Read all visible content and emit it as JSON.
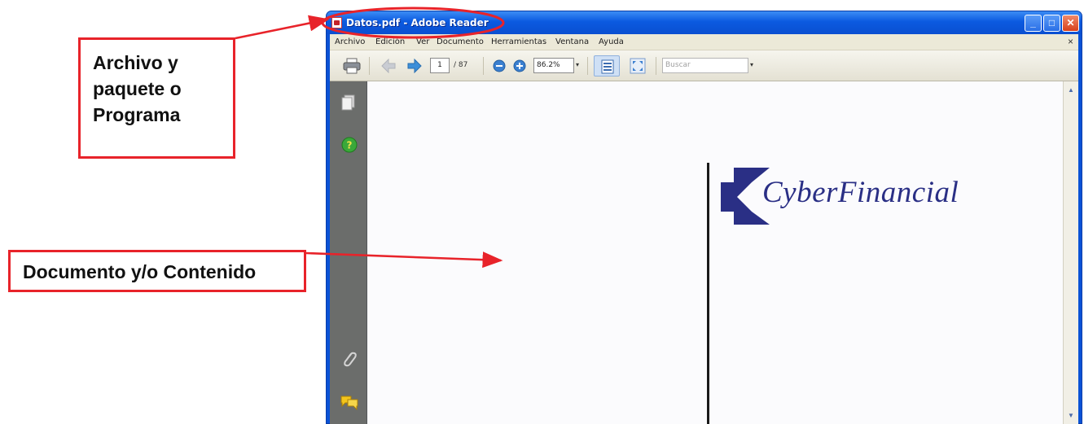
{
  "annotations": {
    "archivo": "Archivo y paquete o Programa",
    "archivo_lines": [
      "Archivo y",
      "paquete o",
      "Programa"
    ],
    "documento": "Documento y/o Contenido"
  },
  "window": {
    "title": "Datos.pdf - Adobe Reader",
    "buttons": {
      "minimize": "_",
      "maximize": "□",
      "close": "✕"
    }
  },
  "menubar": {
    "items": [
      "Archivo",
      "Edición",
      "Ver",
      "Documento",
      "Herramientas",
      "Ventana",
      "Ayuda"
    ],
    "close": "×"
  },
  "toolbar": {
    "page_current": "1",
    "page_total": "/ 87",
    "zoom": "86.2%",
    "search_placeholder": "Buscar"
  },
  "document": {
    "logo_text": "CyberFinancial"
  },
  "colors": {
    "annotation_red": "#e8232a",
    "titlebar_blue": "#0b5ae0",
    "logo_blue": "#2a2f85"
  }
}
